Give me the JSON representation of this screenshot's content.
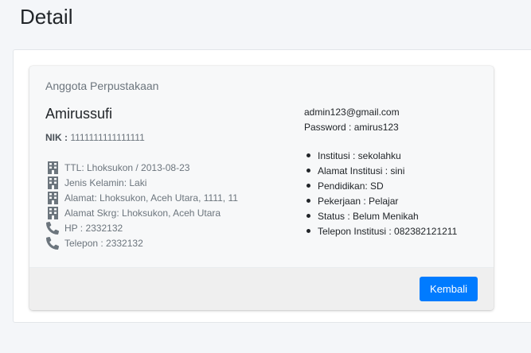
{
  "page": {
    "title": "Detail"
  },
  "card": {
    "header": "Anggota Perpustakaan",
    "name": "Amirussufi",
    "nik_label": "NIK :",
    "nik_value": "1111111111111111",
    "info": [
      {
        "icon": "building-icon",
        "text": "TTL: Lhoksukon / 2013-08-23"
      },
      {
        "icon": "building-icon",
        "text": "Jenis Kelamin: Laki"
      },
      {
        "icon": "building-icon",
        "text": "Alamat: Lhoksukon, Aceh Utara, 1111, 11"
      },
      {
        "icon": "building-icon",
        "text": "Alamat Skrg: Lhoksukon, Aceh Utara"
      },
      {
        "icon": "phone-icon",
        "text": "HP : 2332132"
      },
      {
        "icon": "phone-icon",
        "text": "Telepon : 2332132"
      }
    ],
    "email": "admin123@gmail.com",
    "password": "Password : amirus123",
    "details": [
      "Institusi : sekolahku",
      "Alamat Institusi : sini",
      "Pendidikan: SD",
      "Pekerjaan : Pelajar",
      "Status : Belum Menikah",
      "Telepon Institusi : 082382121211"
    ],
    "back_label": "Kembali"
  },
  "colors": {
    "accent": "#007bff",
    "icon": "#6c757d"
  }
}
